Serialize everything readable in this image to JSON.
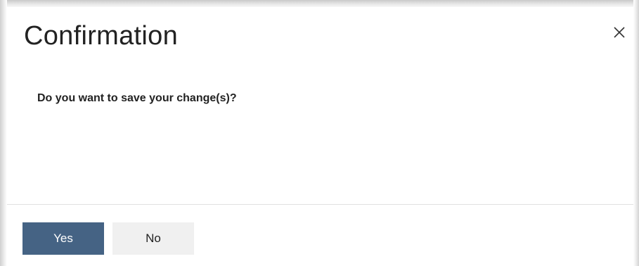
{
  "dialog": {
    "title": "Confirmation",
    "message": "Do you want to save your change(s)?",
    "close_icon": "close-icon",
    "buttons": {
      "yes_label": "Yes",
      "no_label": "No"
    }
  },
  "colors": {
    "primary_button": "#456384",
    "secondary_button": "#f0f0f0",
    "text": "#222222"
  }
}
